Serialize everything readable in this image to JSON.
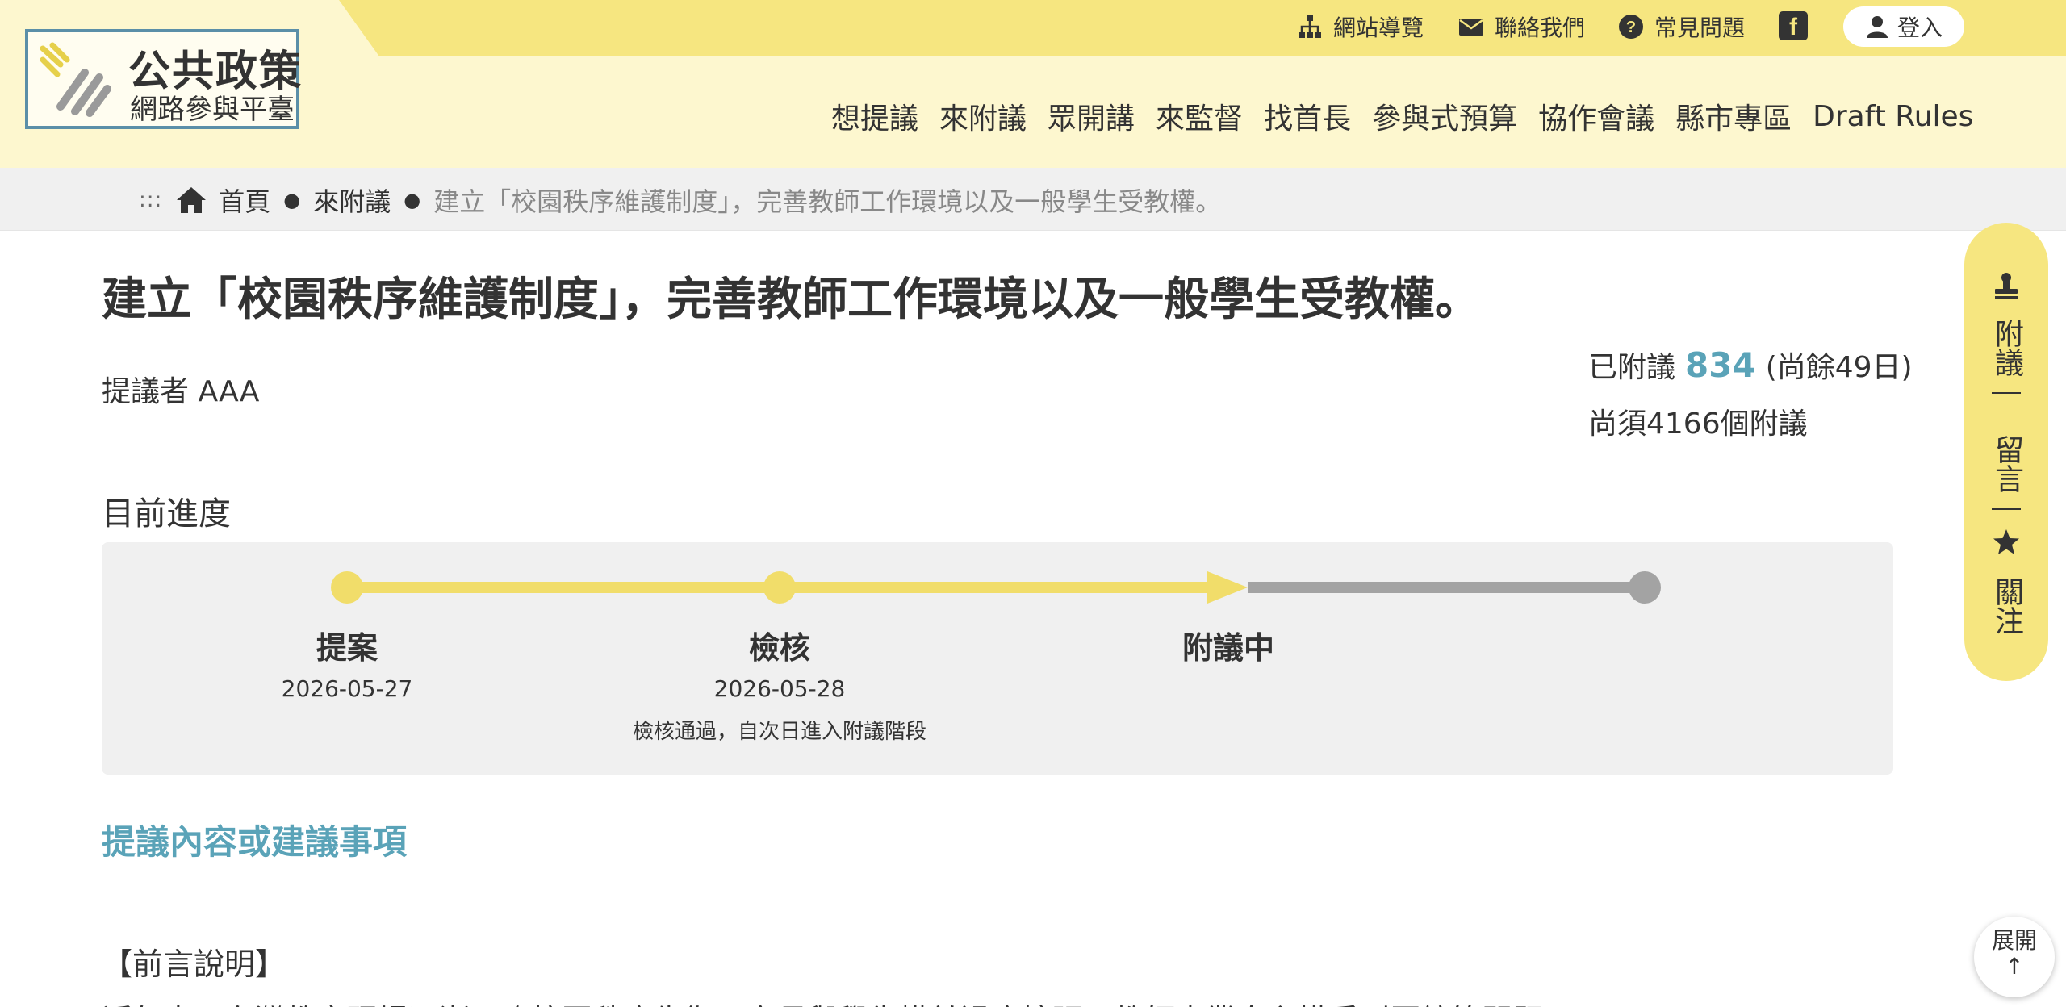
{
  "logo": {
    "title": "公共政策",
    "subtitle": "網路參與平臺"
  },
  "utility_nav": {
    "sitemap": "網站導覽",
    "contact": "聯絡我們",
    "faq": "常見問題",
    "facebook_icon": "facebook-icon",
    "login": "登入"
  },
  "main_nav": [
    "想提議",
    "來附議",
    "眾開講",
    "來監督",
    "找首長",
    "參與式預算",
    "協作會議",
    "縣市專區",
    "Draft Rules"
  ],
  "breadcrumb": {
    "home": "首頁",
    "section": "來附議",
    "current": "建立「校園秩序維護制度」，完善教師工作環境以及一般學生受教權。"
  },
  "proposal": {
    "title": "建立「校園秩序維護制度」，完善教師工作環境以及一般學生受教權。",
    "proposer": "提議者 AAA",
    "endorsed_label": "已附議",
    "endorsed_count": "834",
    "days_left": "(尚餘49日)",
    "needed": "尚須4166個附議"
  },
  "progress": {
    "label": "目前進度",
    "stages": [
      {
        "name": "提案",
        "date": "2026-05-27",
        "note": ""
      },
      {
        "name": "檢核",
        "date": "2026-05-28",
        "note": "檢核通過，自次日進入附議階段"
      },
      {
        "name": "附議中",
        "date": "",
        "note": ""
      }
    ],
    "active_color": "#f1dd6a",
    "inactive_color": "#a3a3a3"
  },
  "content": {
    "section_heading": "提議內容或建議事項",
    "preface": "【前言說明】",
    "first_line": "近年來，台灣教育現場逐漸面臨校園秩序失衡、家長與學生權益過度擴張、教師專業自主權受到壓縮等問題。"
  },
  "side_panel": {
    "endorse": "附議",
    "comment": "留言",
    "follow": "關注"
  },
  "expand": {
    "label": "展開",
    "arrow": "↑"
  },
  "colors": {
    "accent_yellow": "#f6e680",
    "header_bg": "#fdf7cf",
    "teal": "#5aa3b8"
  }
}
